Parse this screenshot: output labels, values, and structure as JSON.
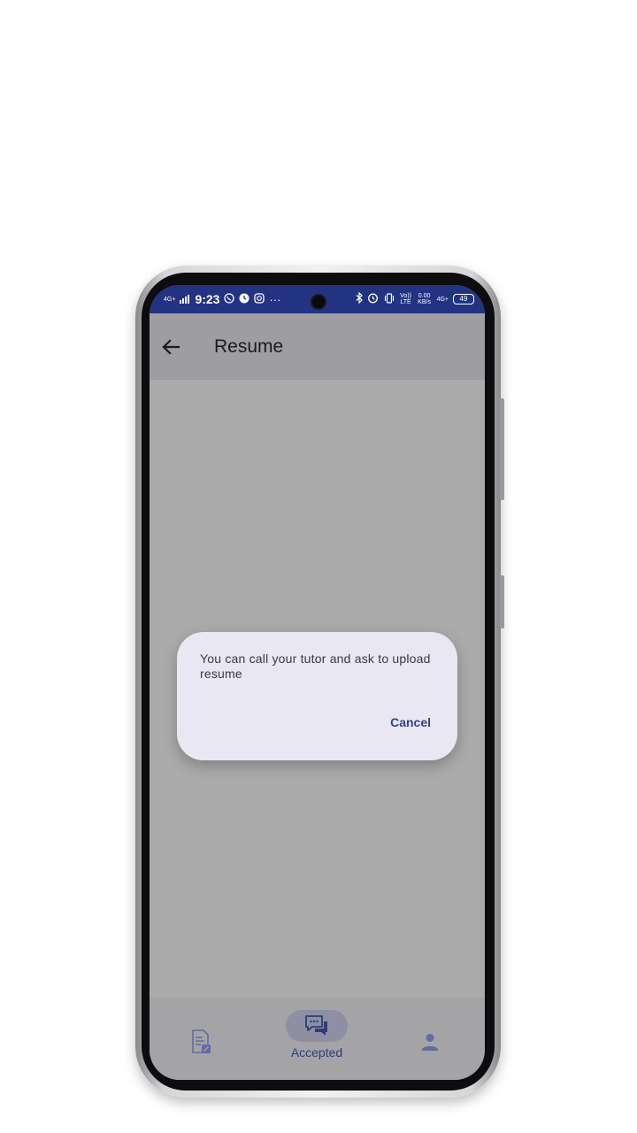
{
  "status_bar": {
    "network_label": "4G+",
    "time": "9:23",
    "more_indicator": "···",
    "volte_label": "Vo)) LTE",
    "data_speed": "0.00 KB/s",
    "network_label_2": "4G+",
    "battery_level": "49"
  },
  "app_bar": {
    "title": "Resume"
  },
  "dialog": {
    "message": "You can call your tutor and ask to upload resume",
    "cancel_label": "Cancel"
  },
  "bottom_nav": {
    "items": [
      {
        "icon": "resume-document-icon",
        "label": ""
      },
      {
        "icon": "chat-bubbles-icon",
        "label": "Accepted",
        "selected": true
      },
      {
        "icon": "person-icon",
        "label": ""
      }
    ]
  },
  "colors": {
    "status_bar": "#223382",
    "scrim": "#ababab",
    "dialog_bg": "#e8e7f2",
    "accent": "#34418a"
  }
}
